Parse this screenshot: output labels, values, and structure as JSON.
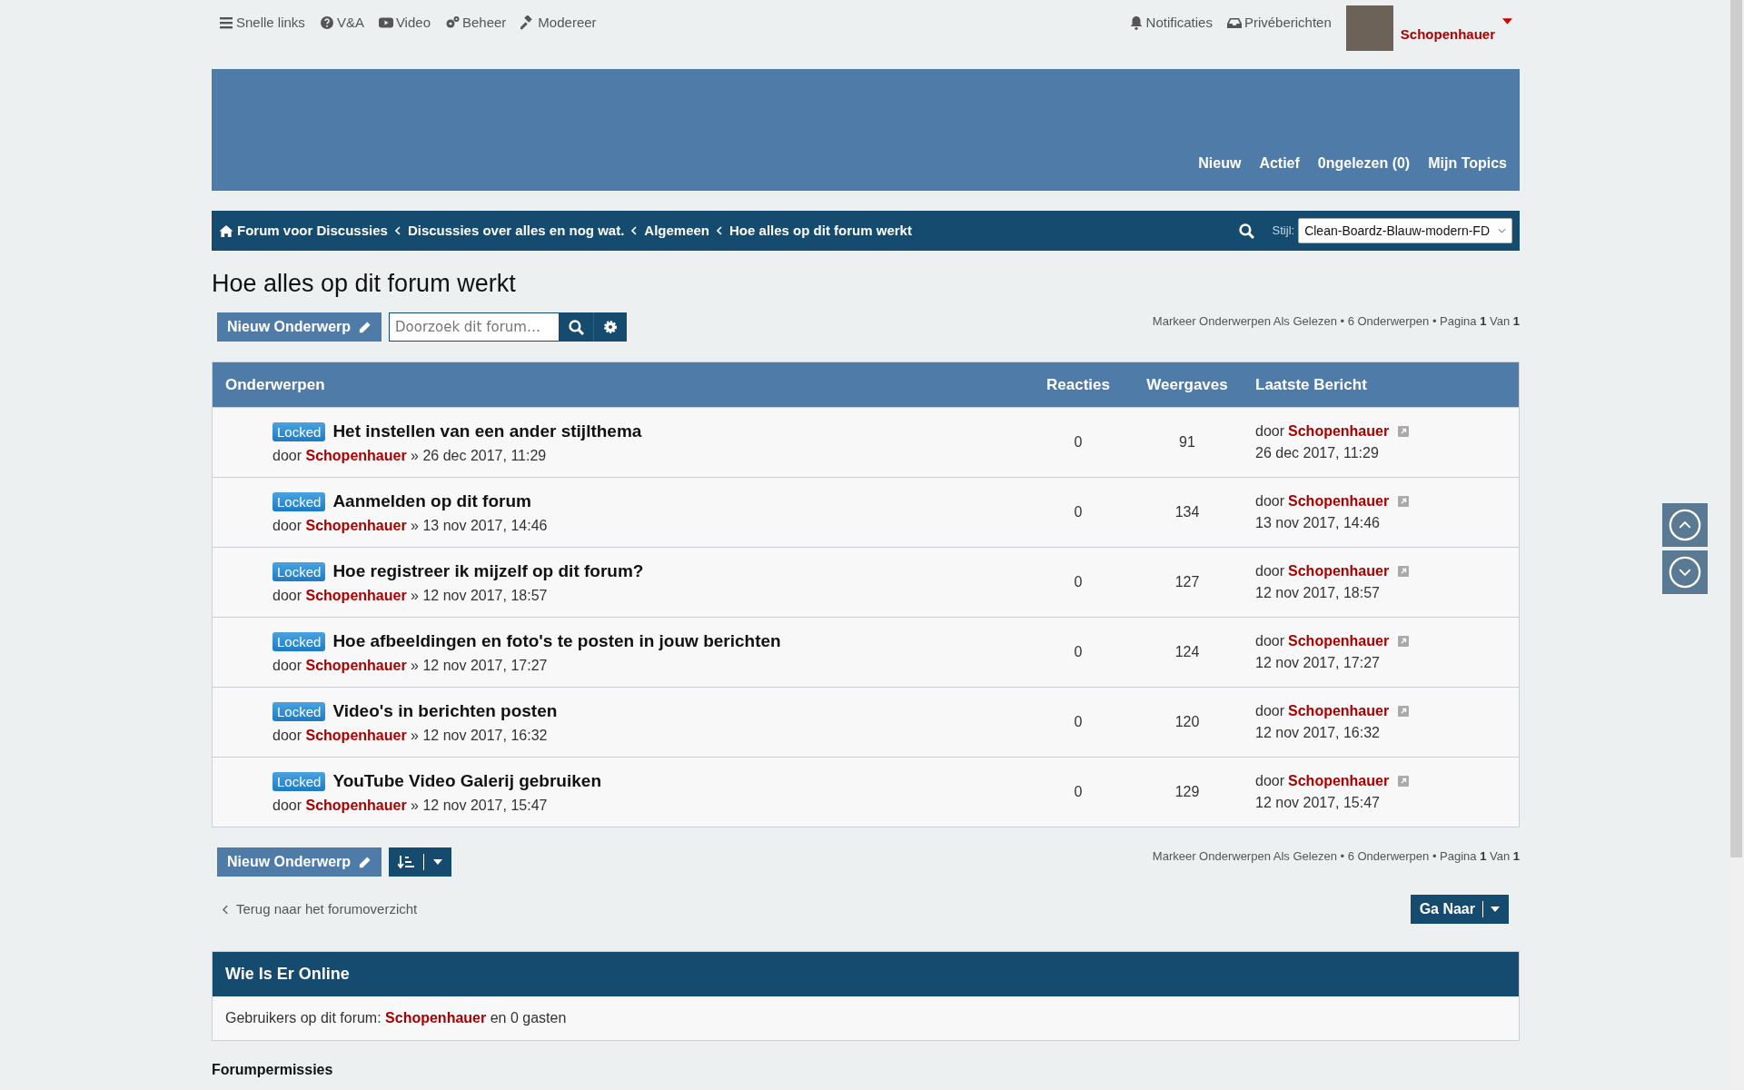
{
  "top_links": [
    {
      "label": "Snelle links"
    },
    {
      "label": "V&A"
    },
    {
      "label": "Video"
    },
    {
      "label": "Beheer"
    },
    {
      "label": "Modereer"
    }
  ],
  "user_links": [
    {
      "label": "Notificaties"
    },
    {
      "label": "Privéberichten"
    }
  ],
  "user": {
    "name": "Schopenhauer"
  },
  "header_nav": [
    "Nieuw",
    "Actief",
    "0ngelezen (0)",
    "Mijn Topics"
  ],
  "breadcrumbs": [
    "Forum voor Discussies",
    "Discussies over alles en nog wat.",
    "Algemeen",
    "Hoe alles op dit forum werkt"
  ],
  "style_select": {
    "label": "Stijl:",
    "value": "Clean-Boardz-Blauw-modern-FD"
  },
  "page_title": "Hoe alles op dit forum werkt",
  "new_topic_button": "Nieuw Onderwerp",
  "search": {
    "placeholder": "Doorzoek dit forum…"
  },
  "pagination_top": {
    "mark_read": "Markeer Onderwerpen Als Gelezen",
    "info": "• 6 Onderwerpen • Pagina **1** Van **1**"
  },
  "table": {
    "columns": [
      "Onderwerpen",
      "Reacties",
      "Weergaves",
      "Laatste Bericht"
    ],
    "rows": [
      {
        "badge": "Locked",
        "title": "Het instellen van een ander stijlthema",
        "by": "door",
        "author": "Schopenhauer",
        "date": "» 26 dec 2017, 11:29",
        "replies": "0",
        "views": "91",
        "last_by": "door",
        "last_author": "Schopenhauer",
        "last_date": "26 dec 2017, 11:29"
      },
      {
        "badge": "Locked",
        "title": "Aanmelden op dit forum",
        "by": "door",
        "author": "Schopenhauer",
        "date": "» 13 nov 2017, 14:46",
        "replies": "0",
        "views": "134",
        "last_by": "door",
        "last_author": "Schopenhauer",
        "last_date": "13 nov 2017, 14:46"
      },
      {
        "badge": "Locked",
        "title": "Hoe registreer ik mijzelf op dit forum?",
        "by": "door",
        "author": "Schopenhauer",
        "date": "» 12 nov 2017, 18:57",
        "replies": "0",
        "views": "127",
        "last_by": "door",
        "last_author": "Schopenhauer",
        "last_date": "12 nov 2017, 18:57"
      },
      {
        "badge": "Locked",
        "title": "Hoe afbeeldingen en foto's te posten in jouw berichten",
        "by": "door",
        "author": "Schopenhauer",
        "date": "» 12 nov 2017, 17:27",
        "replies": "0",
        "views": "124",
        "last_by": "door",
        "last_author": "Schopenhauer",
        "last_date": "12 nov 2017, 17:27"
      },
      {
        "badge": "Locked",
        "title": "Video's in berichten posten",
        "by": "door",
        "author": "Schopenhauer",
        "date": "» 12 nov 2017, 16:32",
        "replies": "0",
        "views": "120",
        "last_by": "door",
        "last_author": "Schopenhauer",
        "last_date": "12 nov 2017, 16:32"
      },
      {
        "badge": "Locked",
        "title": "YouTube Video Galerij gebruiken",
        "by": "door",
        "author": "Schopenhauer",
        "date": "» 12 nov 2017, 15:47",
        "replies": "0",
        "views": "129",
        "last_by": "door",
        "last_author": "Schopenhauer",
        "last_date": "12 nov 2017, 15:47"
      }
    ]
  },
  "new_topic_button_bottom": "Nieuw Onderwerp",
  "pagination_bottom": {
    "mark_read": "Markeer Onderwerpen Als Gelezen",
    "info": "• 6 Onderwerpen • Pagina **1** Van **1**"
  },
  "back_link": "Terug naar het forumoverzicht",
  "jump_button": "Ga Naar",
  "online": {
    "title": "Wie Is Er Online",
    "prefix": "Gebruikers op dit forum:",
    "user": "Schopenhauer",
    "suffix": "en 0 gasten"
  },
  "permissions_title": "Forumpermissies"
}
